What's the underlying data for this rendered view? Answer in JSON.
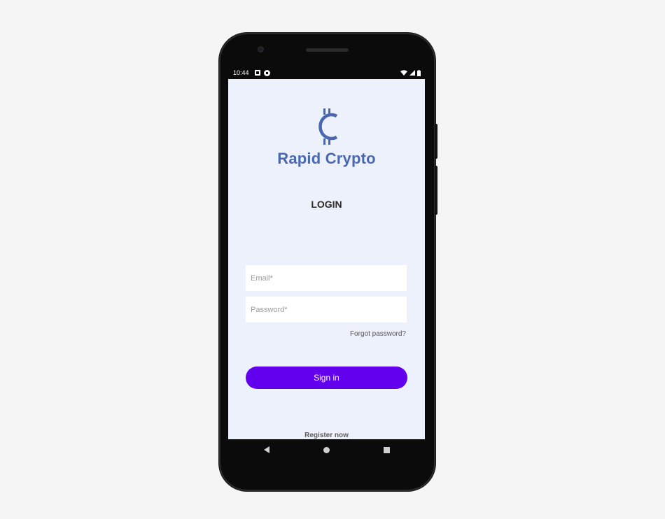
{
  "status_bar": {
    "time": "10:44",
    "icons": [
      "notification-square-icon",
      "notification-circle-icon",
      "wifi-icon",
      "signal-icon",
      "battery-icon"
    ]
  },
  "app": {
    "logo_icon": "cent-coin-icon",
    "name": "Rapid Crypto",
    "brand_color": "#4a68b0"
  },
  "login": {
    "title": "LOGIN",
    "email_placeholder": "Email*",
    "email_value": "",
    "password_placeholder": "Password*",
    "password_value": "",
    "forgot_label": "Forgot password?",
    "signin_label": "Sign in",
    "signin_color": "#6200ee",
    "register_label": "Register now"
  },
  "nav_bar": {
    "buttons": [
      "back-icon",
      "home-icon",
      "recents-icon"
    ]
  },
  "colors": {
    "screen_background": "#edf1fb",
    "page_background": "#f5f5f5",
    "phone_body": "#0b0b0b"
  }
}
